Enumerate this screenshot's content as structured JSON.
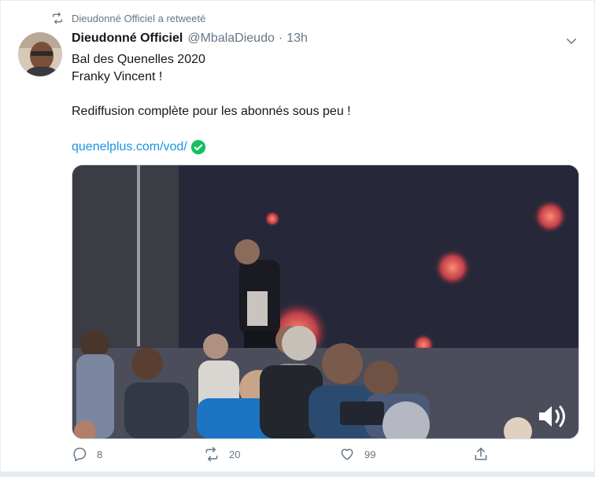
{
  "retweet_context": {
    "icon": "retweet-icon",
    "text": "Dieudonné Officiel a retweeté"
  },
  "author": {
    "display_name": "Dieudonné Officiel",
    "handle": "@MbalaDieudo",
    "separator": "·",
    "time": "13h"
  },
  "tweet": {
    "lines": [
      "Bal des Quenelles 2020",
      "Franky Vincent !",
      "Rediffusion complète pour les abonnés sous peu !"
    ],
    "link_text": "quenelplus.com/vod/",
    "link_badge_icon": "check-circle-icon"
  },
  "media": {
    "type": "video",
    "audio_icon": "volume-icon"
  },
  "actions": {
    "reply_count": "8",
    "retweet_count": "20",
    "like_count": "99"
  },
  "colors": {
    "link": "#1b95e0",
    "muted": "#657786",
    "check_green": "#17bf63",
    "text": "#14171a"
  }
}
